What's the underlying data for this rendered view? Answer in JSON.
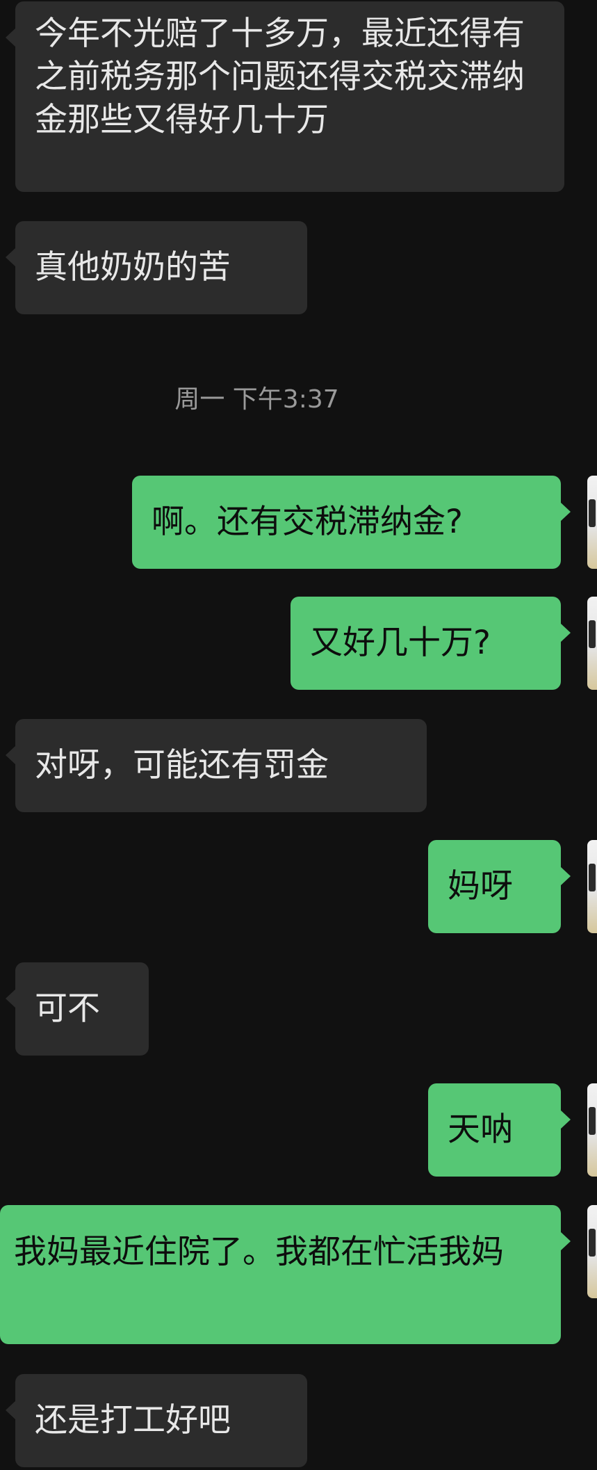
{
  "messages": [
    {
      "side": "in",
      "text": "今年不光赔了十多万，最近还得有之前税务那个问题还得交税交滞纳金那些又得好几十万"
    },
    {
      "side": "in",
      "text": "真他奶奶的苦"
    },
    {
      "side": "out",
      "text": "啊。还有交税滞纳金?"
    },
    {
      "side": "out",
      "text": "又好几十万?"
    },
    {
      "side": "in",
      "text": "对呀，可能还有罚金"
    },
    {
      "side": "out",
      "text": "妈呀"
    },
    {
      "side": "in",
      "text": "可不"
    },
    {
      "side": "out",
      "text": "天呐"
    },
    {
      "side": "out",
      "text": "我妈最近住院了。我都在忙活我妈"
    },
    {
      "side": "in",
      "text": "还是打工好吧"
    }
  ],
  "timestamp": "周一 下午3:37",
  "colors": {
    "background": "#111111",
    "incoming_bubble": "#2c2c2c",
    "outgoing_bubble": "#56c775",
    "timestamp_text": "#9a9a9a"
  },
  "icons": {
    "avatar": "user-avatar-icon"
  }
}
